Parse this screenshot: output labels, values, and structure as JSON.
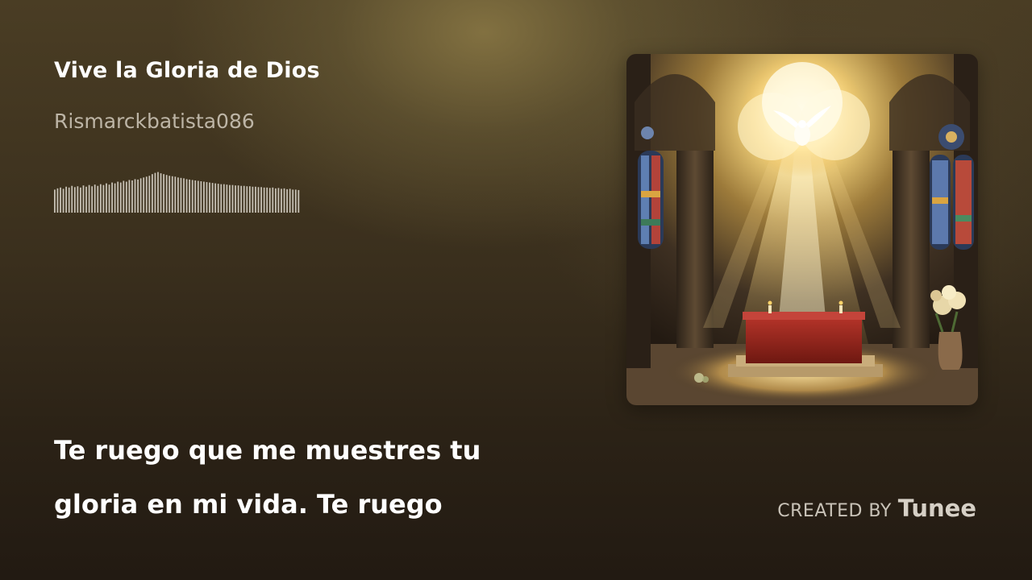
{
  "track": {
    "title": "Vive la Gloria de Dios",
    "artist": "Rismarckbatista086"
  },
  "waveform": {
    "color": "#c8c2b6",
    "levels": [
      0.55,
      0.58,
      0.6,
      0.57,
      0.62,
      0.6,
      0.64,
      0.61,
      0.63,
      0.6,
      0.65,
      0.62,
      0.66,
      0.63,
      0.67,
      0.64,
      0.68,
      0.66,
      0.7,
      0.67,
      0.72,
      0.7,
      0.74,
      0.72,
      0.76,
      0.74,
      0.78,
      0.77,
      0.8,
      0.79,
      0.82,
      0.84,
      0.86,
      0.88,
      0.92,
      0.95,
      0.97,
      0.94,
      0.92,
      0.9,
      0.88,
      0.87,
      0.86,
      0.84,
      0.83,
      0.82,
      0.8,
      0.79,
      0.78,
      0.77,
      0.76,
      0.75,
      0.74,
      0.73,
      0.72,
      0.71,
      0.7,
      0.69,
      0.68,
      0.68,
      0.67,
      0.66,
      0.66,
      0.65,
      0.65,
      0.64,
      0.64,
      0.63,
      0.63,
      0.62,
      0.62,
      0.61,
      0.61,
      0.6,
      0.6,
      0.59,
      0.6,
      0.58,
      0.59,
      0.57,
      0.58,
      0.56,
      0.57,
      0.55,
      0.55,
      0.54
    ]
  },
  "cover": {
    "icon": "church-altar-dove-artwork",
    "glow_color": "#ffe9a8",
    "cloth_color": "#8a1f17"
  },
  "lyrics": {
    "line1": "Te ruego que me muestres tu",
    "line2": "gloria en mi vida. Te ruego"
  },
  "credit": {
    "prefix": "CREATED BY",
    "brand": "Tunee"
  }
}
